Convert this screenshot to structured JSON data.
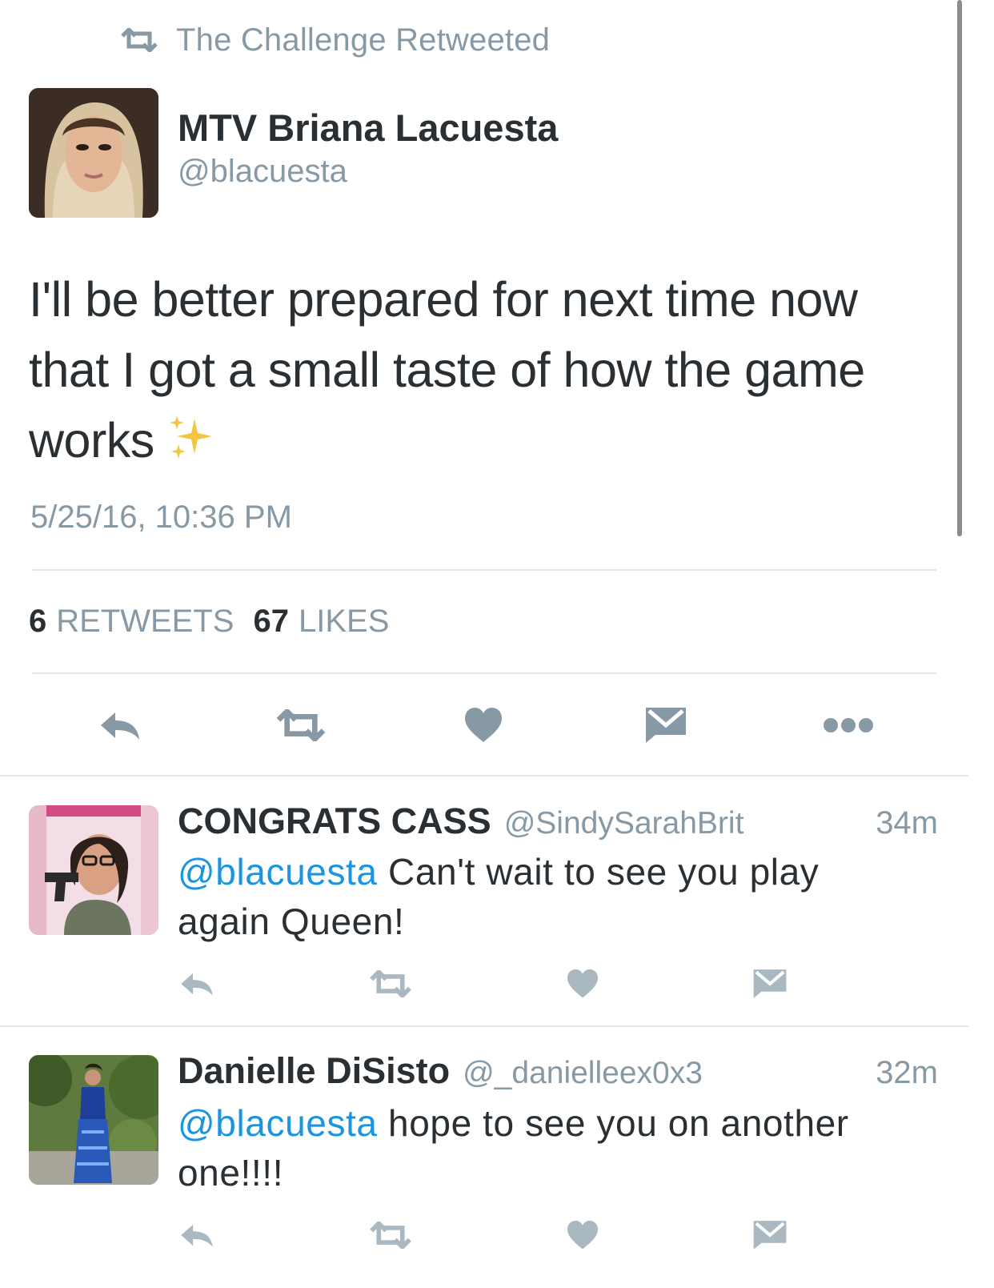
{
  "retweet_context": {
    "label": "The Challenge Retweeted",
    "icon": "retweet-icon"
  },
  "main_tweet": {
    "author_name": "MTV Briana Lacuesta",
    "author_handle": "@blacuesta",
    "text_line1": "I'll be better prepared for next time now",
    "text_line2": "that I got a small taste of how the game",
    "text_line3": "works",
    "emoji": "sparkles",
    "timestamp": "5/25/16, 10:36 PM",
    "retweets_count": "6",
    "retweets_label": "RETWEETS",
    "likes_count": "67",
    "likes_label": "LIKES"
  },
  "actions": [
    "reply-icon",
    "retweet-icon",
    "like-icon",
    "direct-message-icon",
    "more-icon"
  ],
  "replies": [
    {
      "name": "CONGRATS CASS",
      "handle": "@SindySarahBrit",
      "time": "34m",
      "mention": "@blacuesta",
      "text_line1": "Can't wait to see you play",
      "text_line2": "again Queen!"
    },
    {
      "name": "Danielle DiSisto",
      "handle": "@_danielleex0x3",
      "time": "32m",
      "mention": "@blacuesta",
      "text_line1": "hope to see you on another",
      "text_line2": "one!!!!"
    }
  ],
  "colors": {
    "text": "#292f33",
    "secondary": "#8899a6",
    "link": "#1b95e0",
    "divider": "#e1e8ed"
  }
}
